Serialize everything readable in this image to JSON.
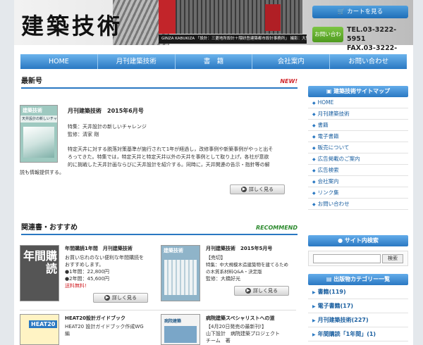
{
  "header": {
    "logo": "建築技術",
    "credit": "GINZA KABUKIZA 「設計：三菱地所設計＋隈研吾建築都市設計事務所」 撮影：大野繁",
    "cart_button": "カートを見る",
    "inquiry_button": "お問い合わせ",
    "tel": "TEL.03-3222-5951",
    "fax": "FAX.03-3222-5957"
  },
  "nav": [
    "HOME",
    "月刊建築技術",
    "書　籍",
    "会社案内",
    "お問い合わせ"
  ],
  "latest": {
    "heading": "最新号",
    "tag": "NEW!",
    "cover_title": "建築技術",
    "cover_sub": "天井設計の新しいチャレンジ",
    "title": "月刊建築技術　2015年6月号",
    "feature_line1": "特集：天井設計の新しいチャレンジ",
    "feature_line2": "監修：清家 剛",
    "desc_lines": [
      "特定天井に対する脱落対策基準が施行されて1年が経過し，改修事例や新築事例がやっと出そ",
      "ろってきた。特集では，特定天井と特定天井以外の天井を事例として取り上げ，各社が意欲",
      "的に挑戦した天井計画ならびに天井設計を紹介する。同時に，天井関連の告示・指針等の解",
      "説も情報提供する。"
    ],
    "more": "詳しく見る"
  },
  "recommend": {
    "heading": "関連書・おすすめ",
    "tag": "RECOMMEND",
    "items": [
      {
        "cover": "年間購読",
        "title": "年間購読1年間　月刊建築技術",
        "lines": [
          "お買い忘れのない便利な年間購読を",
          "おすすめします。",
          "●1年間：22,800円",
          "●2年間：45,600円",
          "送料無料!"
        ],
        "more": "詳しく見る"
      },
      {
        "cover": "建築技術",
        "title": "月刊建築技術　2015年5月号",
        "lines": [
          "【売切】",
          "特集：中大規模木造建築物を建てるため",
          "の木質系材料Q&A・決定版",
          "監修：大橋好光"
        ],
        "more": "詳しく見る"
      },
      {
        "cover": "HEAT20",
        "title": "HEAT20設計ガイドブック",
        "lines": [
          "HEAT20 設計ガイドブック作成WG",
          "編"
        ],
        "more": "詳しく見る"
      },
      {
        "cover": "病院建築",
        "title": "病院建築スペシャリストへの道",
        "lines": [
          "【4月20日発売の最新刊!】",
          "山下設計　病院建築プロジェクト",
          "チーム　著"
        ],
        "more": "詳しく見る"
      }
    ]
  },
  "sitemap": {
    "heading": "建築技術サイトマップ",
    "items": [
      "HOME",
      "月刊建築技術",
      "書籍",
      "電子書籍",
      "販売について",
      "広告掲載のご案内",
      "広告検索",
      "会社案内",
      "リンク集",
      "お問い合わせ"
    ]
  },
  "site_search": {
    "heading": "サイト内検索",
    "button": "検索",
    "value": ""
  },
  "categories": {
    "heading": "出版物カテゴリー一覧",
    "items": [
      "書籍(119)",
      "電子書籍(17)",
      "月刊建築技術(227)",
      "年間購読「1年間」(1)"
    ]
  },
  "colors": {
    "nav_blue": "#2a78c2",
    "new_red": "#d2262b",
    "recommend_green": "#2c8a2e"
  }
}
